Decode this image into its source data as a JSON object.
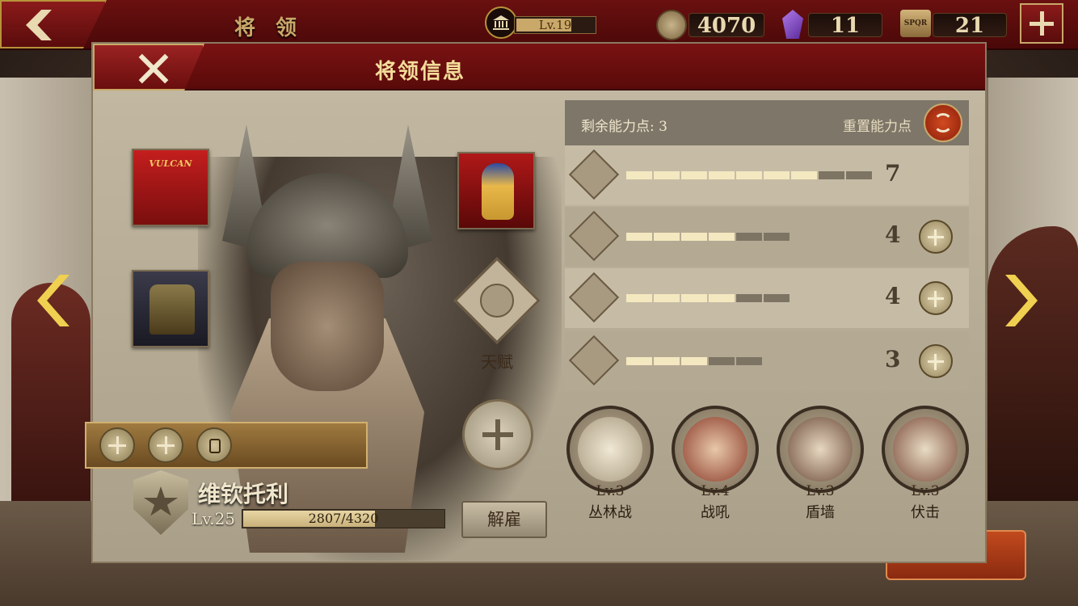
{
  "topbar": {
    "title": "将 领",
    "level": "Lv.19",
    "coins": "4070",
    "gems": "11",
    "spqr_badge": "SPQR",
    "spqr": "21"
  },
  "modal": {
    "title": "将领信息"
  },
  "equipment": {
    "banner_text": "VULCAN"
  },
  "talent": {
    "label": "天赋"
  },
  "general": {
    "name": "维钦托利",
    "level": "Lv.25",
    "exp": "2807/4320",
    "exp_fraction": 0.65,
    "dismiss_label": "解雇"
  },
  "stats": {
    "remaining_label": "剩余能力点: 3",
    "reset_label": "重置能力点",
    "rows": [
      {
        "icon": "sword-icon",
        "value": "7",
        "filled": 7,
        "total": 9
      },
      {
        "icon": "horse-icon",
        "value": "4",
        "filled": 4,
        "total": 6
      },
      {
        "icon": "bow-icon",
        "value": "4",
        "filled": 4,
        "total": 6
      },
      {
        "icon": "anchor-icon",
        "value": "3",
        "filled": 3,
        "total": 5
      }
    ]
  },
  "skills": [
    {
      "level": "Lv.3",
      "name": "丛林战",
      "icon": "forest-icon"
    },
    {
      "level": "Lv.4",
      "name": "战吼",
      "icon": "warcry-icon"
    },
    {
      "level": "Lv.3",
      "name": "盾墙",
      "icon": "shield-wall-icon"
    },
    {
      "level": "Lv.3",
      "name": "伏击",
      "icon": "ambush-icon"
    }
  ],
  "colors": {
    "header_red": "#6a1010",
    "gold": "#c9a86a",
    "panel": "#b5aa94",
    "accent_yellow": "#f0d050"
  }
}
